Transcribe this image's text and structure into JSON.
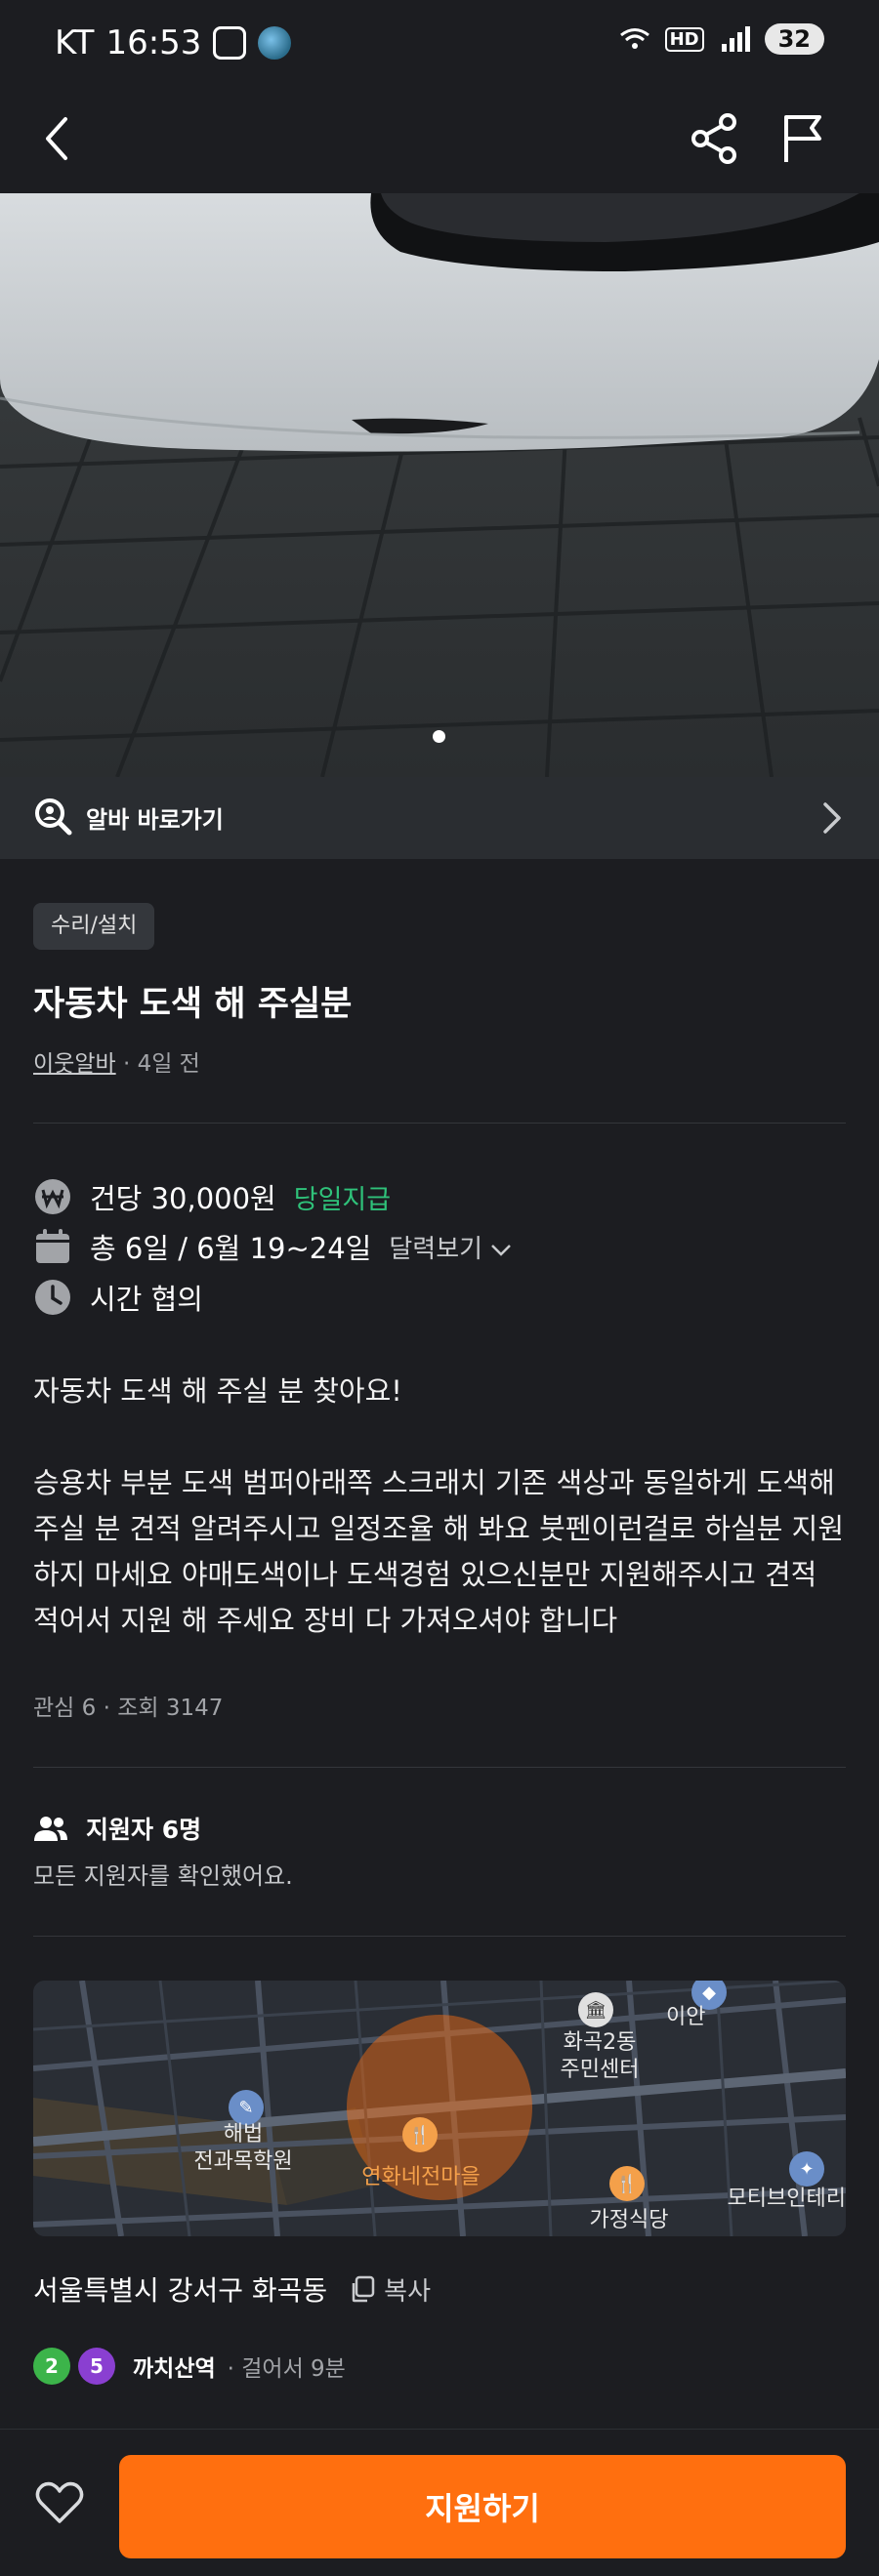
{
  "status_bar": {
    "carrier": "KT",
    "time": "16:53",
    "network_badge": "HD",
    "battery": "32"
  },
  "top_nav": {
    "back_icon": "chevron-left-icon",
    "share_icon": "share-icon",
    "report_icon": "flag-icon"
  },
  "hero": {
    "image_count_dots": 1,
    "active_dot": 0
  },
  "shortcut": {
    "label": "알바 바로가기"
  },
  "post": {
    "category": "수리/설치",
    "title": "자동차 도색 해 주실분",
    "author": "이웃알바",
    "time_ago": "· 4일 전",
    "pay": "건당 30,000원",
    "pay_badge": "당일지급",
    "schedule": "총 6일 / 6월 19~24일",
    "calendar_link": "달력보기",
    "time": "시간 협의",
    "description_line1": "자동차 도색 해 주실 분 찾아요!",
    "description_body_1": "승용차 부분 도색 범퍼아래쪽 스크래치 기존 색상과 동일하게 도색해",
    "description_body_2": "주실 분 견적 알려주시고 일정조율 해 봐요 붓펜이런걸로 하실분 지원",
    "description_body_3": "하지 마세요 야매도색이나 도색경험 있으신분만 지원해주시고 견적",
    "description_body_4": "적어서 지원 해 주세요 장비 다 가져오셔야 합니다",
    "stats": "관심 6 · 조회 3147"
  },
  "applicants": {
    "title": "지원자 6명",
    "note": "모든 지원자를 확인했어요."
  },
  "map": {
    "labels": {
      "ian": "이안",
      "hwagok2": "화곡2동",
      "community_center": "주민센터",
      "haebeop": "해법",
      "academy": "전과목학원",
      "village": "연화네전마을",
      "restaurant": "가정식당",
      "motive": "모티브인테리"
    }
  },
  "location": {
    "address": "서울특별시 강서구 화곡동",
    "copy_label": "복사",
    "line_a": "2",
    "line_b": "5",
    "station": "까치산역",
    "walk": "· 걸어서 9분"
  },
  "bottom": {
    "apply_label": "지원하기"
  },
  "colors": {
    "background": "#1c1d21",
    "accent": "#ff6f0f",
    "pay_badge": "#2fc27a",
    "line2": "#3cb44a",
    "line5": "#8a3fd1"
  }
}
